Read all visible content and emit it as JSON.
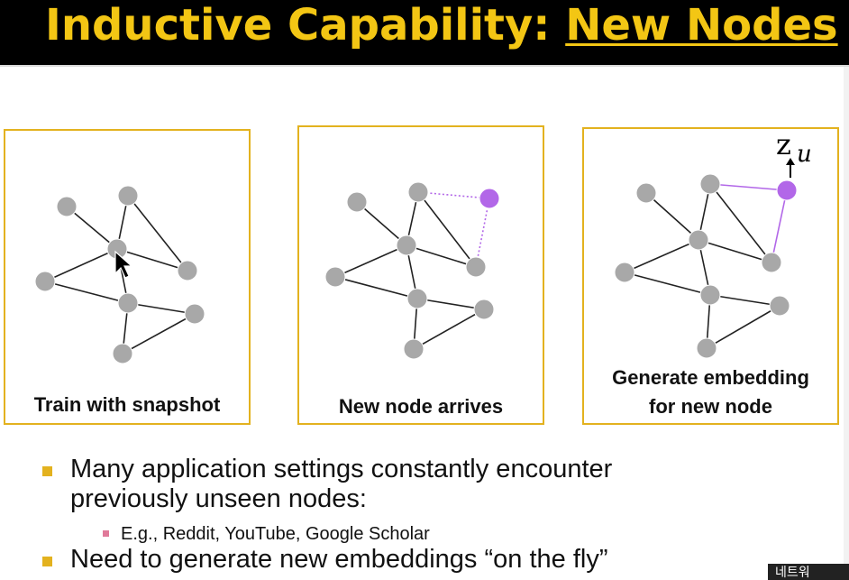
{
  "slide": {
    "title_prefix": "Inductive Capability: ",
    "title_emphasis": "New Nodes"
  },
  "panels": [
    {
      "caption_line1": "Train with snapshot",
      "caption_line2": ""
    },
    {
      "caption_line1": "New node arrives",
      "caption_line2": ""
    },
    {
      "caption_line1": "Generate embedding",
      "caption_line2": "for new node",
      "embedding_label": "z",
      "embedding_subscript": "u"
    }
  ],
  "bullets": [
    {
      "text_line1": "Many application settings constantly encounter",
      "text_line2": "previously unseen nodes:"
    },
    {
      "text_line1": "Need to generate new embeddings “on the fly”"
    }
  ],
  "sub_bullets": [
    {
      "text": "E.g., Reddit, YouTube, Google Scholar"
    }
  ],
  "corner_badge": {
    "text": "네트워"
  },
  "colors": {
    "title_bg": "#000000",
    "title_text": "#f3c614",
    "panel_border": "#e3b21f",
    "node_gray": "#a8a8a8",
    "node_new": "#b267e8",
    "bullet": "#e3b21f",
    "sub_bullet": "#e07a9a"
  },
  "icons": [
    "cursor-arrow-icon"
  ]
}
